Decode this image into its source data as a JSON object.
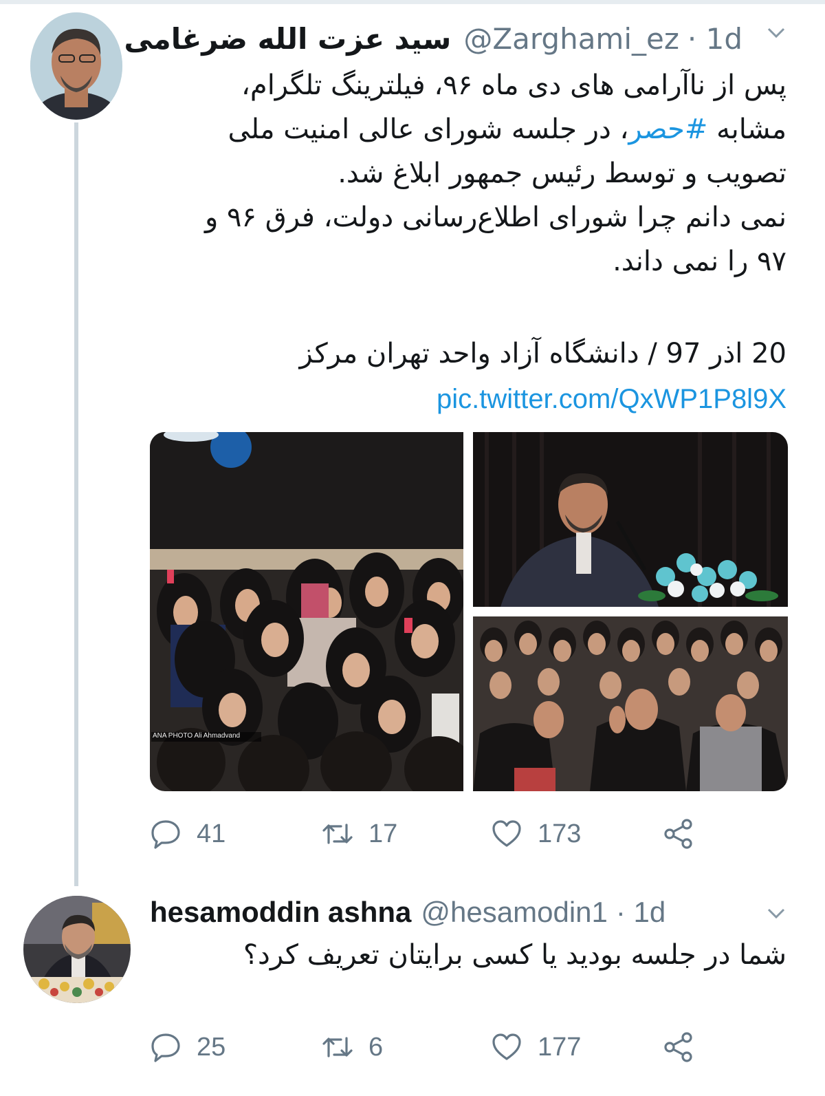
{
  "tweet1": {
    "display_name": "سید عزت الله ضرغامی",
    "handle": "@Zarghami_ez",
    "time": "· 1d",
    "lines": [
      "پس از ناآرامی های دی ماه ۹۶، فیلترینگ تلگرام،",
      "مشابه ",
      "تصویب و توسط رئیس جمهور ابلاغ شد.",
      "نمی دانم چرا شورای اطلاع‌رسانی دولت، فرق ۹۶ و",
      "۹۷ را نمی داند."
    ],
    "hashtag": "#حصر",
    "line2_rest": "، در جلسه شورای عالی امنیت ملی",
    "caption": "20 اذر 97 / دانشگاه آزاد واحد تهران مرکز",
    "link": "pic.twitter.com/QxWP1P8l9X",
    "media_credit": "ANA PHOTO  Ali Ahmadvand",
    "replies": "41",
    "retweets": "17",
    "likes": "173"
  },
  "tweet2": {
    "display_name": "hesamoddin ashna",
    "handle": "@hesamodin1",
    "time": "· 1d",
    "text": "شما در جلسه بودید یا کسی برایتان تعریف کرد؟",
    "replies": "25",
    "retweets": "6",
    "likes": "177"
  },
  "icons": [
    "reply-icon",
    "retweet-icon",
    "heart-icon",
    "share-icon",
    "chevron-down-icon"
  ],
  "colors": {
    "link": "#1b95e0",
    "muted": "#657786",
    "thread": "#ccd6dd"
  }
}
